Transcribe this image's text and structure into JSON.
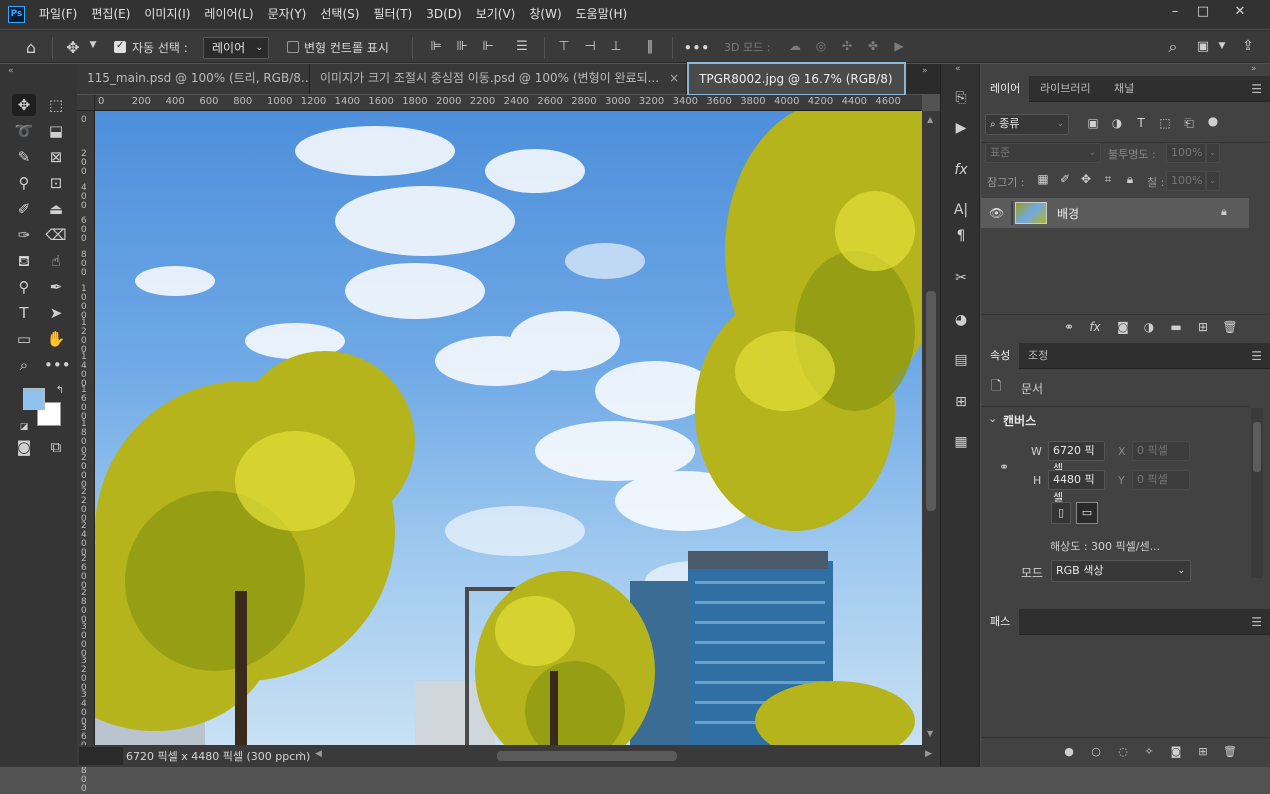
{
  "app": {
    "logo": "Ps"
  },
  "menubar": {
    "items": [
      "파일(F)",
      "편집(E)",
      "이미지(I)",
      "레이어(L)",
      "문자(Y)",
      "선택(S)",
      "필터(T)",
      "3D(D)",
      "보기(V)",
      "창(W)",
      "도움말(H)"
    ]
  },
  "window_controls": {
    "minimize": "–",
    "maximize": "□",
    "close": "✕"
  },
  "options_bar": {
    "auto_select_label": "자동 선택 :",
    "auto_select_checked": true,
    "auto_select_target": "레이어",
    "transform_controls_label": "변형 컨트롤 표시",
    "transform_controls_checked": false,
    "more": "•••",
    "three_d_mode_label": "3D 모드 :"
  },
  "tabs": [
    {
      "label": "115_main.psd @ 100% (트리, RGB/8...",
      "close": "×",
      "active": false
    },
    {
      "label": "이미지가 크기 조절시 중심점 이동.psd @ 100% (변형이 완료되...",
      "close": "×",
      "active": false
    },
    {
      "label": "TPGR8002.jpg @ 16.7% (RGB/8)",
      "close": "×",
      "active": true
    }
  ],
  "ruler": {
    "h_ticks": [
      "0",
      "200",
      "400",
      "600",
      "800",
      "1000",
      "1200",
      "1400",
      "1600",
      "1800",
      "2000",
      "2200",
      "2400",
      "2600",
      "2800",
      "3000",
      "3200",
      "3400",
      "3600",
      "3800",
      "4000",
      "4200",
      "4400",
      "4600"
    ],
    "v_ticks": [
      [
        "0"
      ],
      [
        "2",
        "0",
        "0"
      ],
      [
        "4",
        "0",
        "0"
      ],
      [
        "6",
        "0",
        "0"
      ],
      [
        "8",
        "0",
        "0"
      ],
      [
        "1",
        "0",
        "0",
        "0"
      ],
      [
        "1",
        "2",
        "0",
        "0"
      ],
      [
        "1",
        "4",
        "0",
        "0"
      ],
      [
        "1",
        "6",
        "0",
        "0"
      ],
      [
        "1",
        "8",
        "0",
        "0"
      ],
      [
        "2",
        "0",
        "0",
        "0"
      ],
      [
        "2",
        "2",
        "0",
        "0"
      ],
      [
        "2",
        "4",
        "0",
        "0"
      ],
      [
        "2",
        "6",
        "0",
        "0"
      ],
      [
        "2",
        "8",
        "0",
        "0"
      ],
      [
        "3",
        "0",
        "0",
        "0"
      ],
      [
        "3",
        "2",
        "0",
        "0"
      ],
      [
        "3",
        "4",
        "0",
        "0"
      ],
      [
        "3",
        "6",
        "0",
        "0"
      ],
      [
        "3",
        "8",
        "0",
        "0"
      ]
    ]
  },
  "statusbar": {
    "text": "6720 픽셀 x 4480 픽셀 (300 ppcm)",
    "arrow": "›"
  },
  "colors": {
    "foreground": "#8fc3ee",
    "background": "#ffffff",
    "accent": "#8ab6d8"
  },
  "layers_panel": {
    "tabs": [
      "레이어",
      "라이브러리",
      "채널"
    ],
    "filter_label": "종류",
    "blend_mode": "표준",
    "opacity_label": "불투명도 :",
    "opacity_value": "100%",
    "lock_label": "잠그기 :",
    "fill_label": "칠 :",
    "fill_value": "100%",
    "layers": [
      {
        "name": "배경",
        "visible": true,
        "locked": true
      }
    ]
  },
  "properties_panel": {
    "tabs": [
      "속성",
      "조정"
    ],
    "doc_label": "문서",
    "section": "캔버스",
    "w_label": "W",
    "w_value": "6720 픽셀",
    "h_label": "H",
    "h_value": "4480 픽셀",
    "x_label": "X",
    "x_placeholder": "0 픽셀",
    "y_label": "Y",
    "y_placeholder": "0 픽셀",
    "resolution": "해상도 : 300 픽셀/센...",
    "mode_label": "모드",
    "mode_value": "RGB 색상"
  },
  "paths_panel": {
    "tabs": [
      "패스"
    ]
  }
}
